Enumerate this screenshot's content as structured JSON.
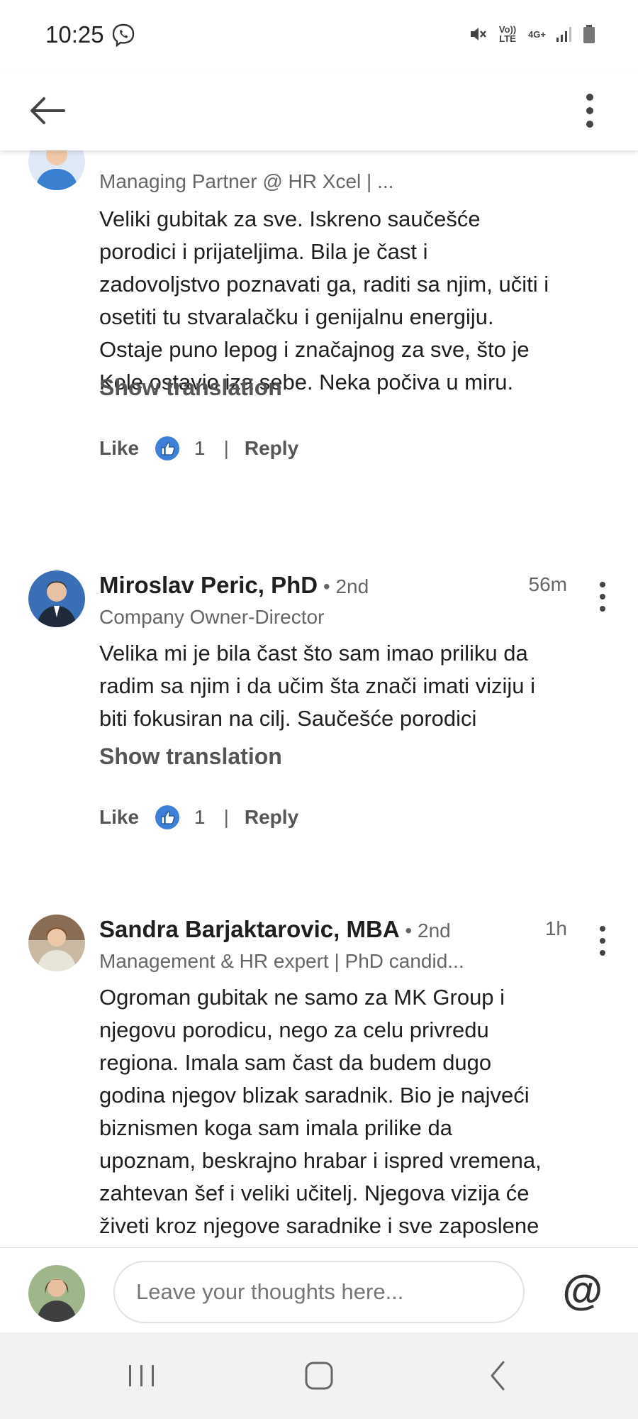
{
  "status_bar": {
    "time": "10:25",
    "volte": "Vo)) LTE",
    "network": "4G+"
  },
  "comments": [
    {
      "headline": "Managing Partner @ HR Xcel | ...",
      "body": "Veliki gubitak za sve. Iskreno saučešće\nporodici i prijateljima. Bila je čast i\nzadovoljstvo poznavati ga, raditi sa njim, učiti i\nosetiti tu stvaralačku i genijalnu energiju.\nOstaje puno lepog i značajnog za sve, što je\nKole ostavio iza sebe. Neka počiva u miru.",
      "show_translation": "Show translation",
      "like_label": "Like",
      "like_count": "1",
      "separator": "|",
      "reply_label": "Reply"
    },
    {
      "name": "Miroslav Peric, PhD",
      "degree": " • 2nd",
      "time": "56m",
      "headline": "Company Owner-Director",
      "body": "Velika  mi je bila čast što sam imao priliku da\nradim sa njim i da učim šta znači imati viziju i\nbiti fokusiran na cilj. Saučešće porodici",
      "show_translation": "Show translation",
      "like_label": "Like",
      "like_count": "1",
      "separator": "|",
      "reply_label": "Reply"
    },
    {
      "name": "Sandra Barjaktarovic, MBA",
      "degree": " • 2nd",
      "time": "1h",
      "headline": "Management & HR expert | PhD candid...",
      "body": "Ogroman gubitak ne samo za MK Group i\nnjegovu porodicu, nego za celu privredu\nregiona. Imala sam čast da budem dugo\ngodina njegov blizak saradnik. Bio je najveći\nbiznismen koga sam imala prilike da\nupoznam, beskrajno hrabar i ispred vremena,\nzahtevan šef i veliki učitelj. Njegova vizija će\nživeti kroz njegove saradnike i sve zaposlene"
    }
  ],
  "compose": {
    "placeholder": "Leave your thoughts here...",
    "mention_symbol": "@"
  },
  "colors": {
    "reaction_blue": "#3d7fd6",
    "text": "#1f1f1f",
    "muted": "#666666"
  }
}
